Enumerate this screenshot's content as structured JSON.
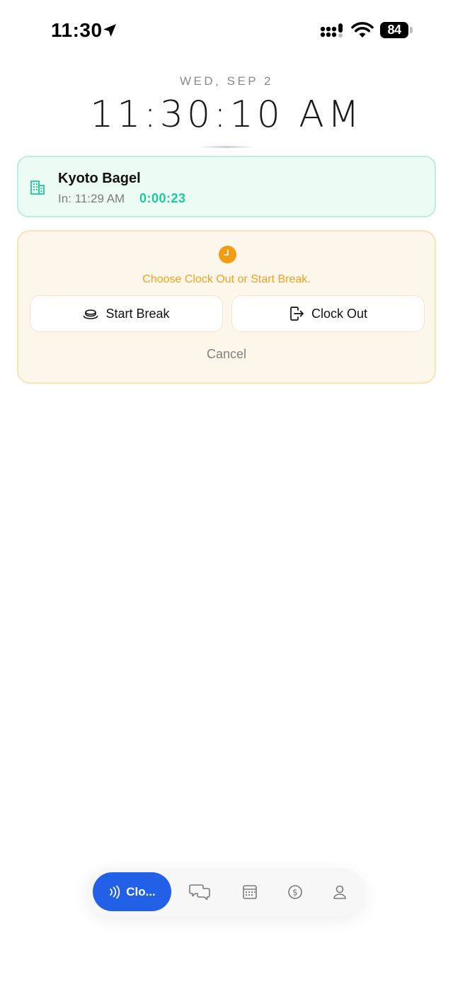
{
  "status_bar": {
    "time": "11:30",
    "battery": "84",
    "icons": [
      "location-arrow-icon",
      "cellular-signal-icon",
      "wifi-icon",
      "battery-icon"
    ]
  },
  "header": {
    "date": "WED, SEP 2",
    "clock": "11:30:10 AM"
  },
  "location_card": {
    "name": "Kyoto Bagel",
    "clock_in": "In: 11:29 AM",
    "elapsed": "0:00:23",
    "icon": "building-icon"
  },
  "prompt": {
    "message": "Choose Clock Out or Start Break.",
    "start_break_label": "Start Break",
    "clock_out_label": "Clock Out",
    "cancel_label": "Cancel",
    "icon": "clock-icon"
  },
  "tab_bar": {
    "active_label": "Clo...",
    "tabs": [
      {
        "icon": "nfc-icon",
        "label": "Clo..."
      },
      {
        "icon": "chat-icon"
      },
      {
        "icon": "calendar-icon"
      },
      {
        "icon": "dollar-icon"
      },
      {
        "icon": "profile-icon"
      }
    ]
  },
  "colors": {
    "accent": "#2260e8",
    "teal": "#1ec99a",
    "warning": "#f0a21c",
    "card_green_bg": "#ecfbf4",
    "card_orange_bg": "#fdf6ea"
  }
}
